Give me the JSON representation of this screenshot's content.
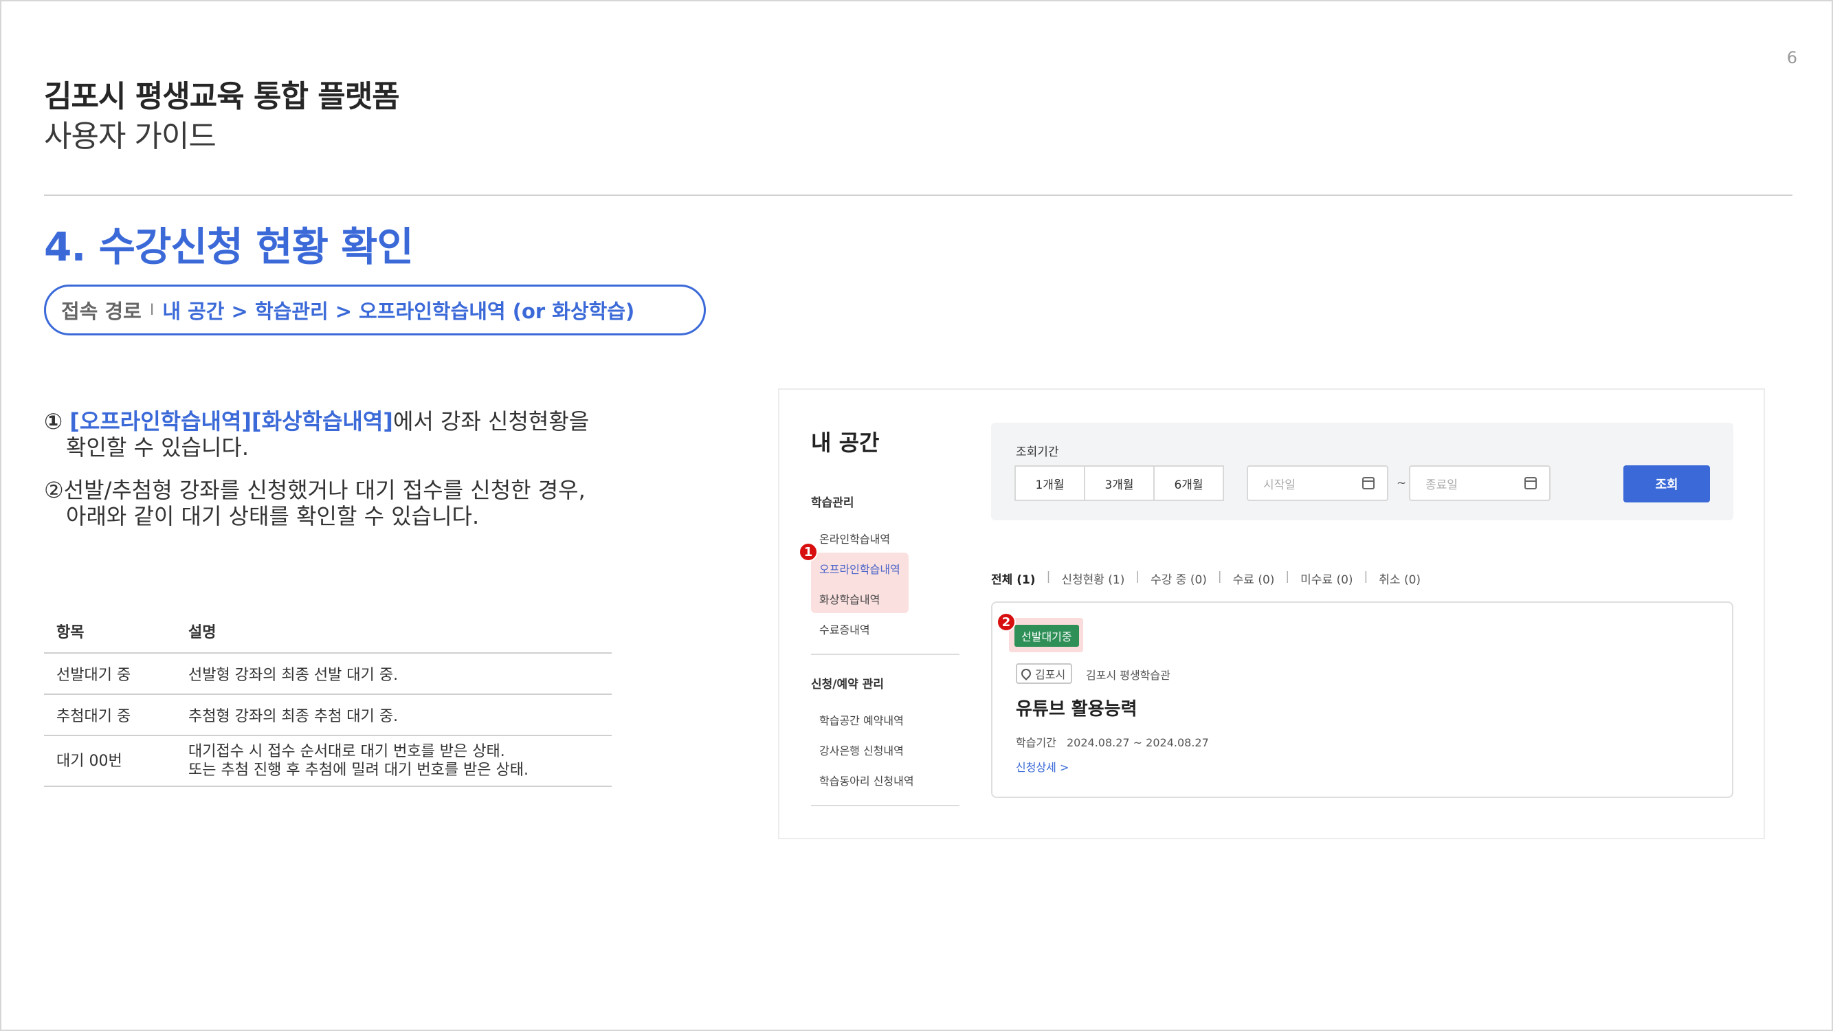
{
  "page": {
    "number": "6",
    "doc_title": "김포시 평생교육 통합 플랫폼",
    "doc_subtitle": "사용자 가이드",
    "section_title": "4. 수강신청 현황 확인",
    "path": {
      "label": "접속 경로",
      "separator": "I",
      "value": "내 공간 > 학습관리 > 오프라인학습내역 (or 화상학습)"
    }
  },
  "description": {
    "item1": {
      "num": "①",
      "highlight": "[오프라인학습내역][화상학습내역]",
      "text_line1": "에서 강좌 신청현황을",
      "text_line2": "확인할 수 있습니다."
    },
    "item2": {
      "line1": "②선발/추첨형 강좌를 신청했거나 대기 접수를 신청한 경우,",
      "line2": "아래와 같이 대기 상태를 확인할 수 있습니다."
    }
  },
  "table": {
    "headers": [
      "항목",
      "설명"
    ],
    "rows": [
      {
        "item": "선발대기 중",
        "desc1": "선발형 강좌의 최종 선발 대기 중.",
        "desc2": ""
      },
      {
        "item": "추첨대기 중",
        "desc1": "추첨형 강좌의 최종 추첨 대기 중.",
        "desc2": ""
      },
      {
        "item": "대기 00번",
        "desc1": "대기접수 시 접수 순서대로 대기 번호를 받은 상태.",
        "desc2": "또는 추첨 진행 후 추첨에 밀려 대기 번호를 받은 상태."
      }
    ]
  },
  "screenshot": {
    "title": "내 공간",
    "sidebar": {
      "group1": "학습관리",
      "group1_items": [
        "온라인학습내역",
        "오프라인학습내역",
        "화상학습내역",
        "수료증내역"
      ],
      "group2": "신청/예약 관리",
      "group2_items": [
        "학습공간 예약내역",
        "강사은행 신청내역",
        "학습동아리 신청내역"
      ]
    },
    "markers": [
      "1",
      "2"
    ],
    "filter": {
      "label": "조회기간",
      "periods": [
        "1개월",
        "3개월",
        "6개월"
      ],
      "start_placeholder": "시작일",
      "tilde": "~",
      "end_placeholder": "종료일",
      "search_label": "조회"
    },
    "tabs": [
      "전체 (1)",
      "신청현황 (1)",
      "수강 중 (0)",
      "수료 (0)",
      "미수료 (0)",
      "취소 (0)"
    ],
    "tab_separator": "|",
    "card": {
      "status": "선발대기중",
      "location": "김포시",
      "org": "김포시 평생학습관",
      "course_title": "유튜브 활용능력",
      "period_label": "학습기간",
      "period_value": "2024.08.27 ~ 2024.08.27",
      "detail_link": "신청상세 >"
    },
    "colors": {
      "accent": "#3b6ad8",
      "status_green": "#2e8f57",
      "marker_red": "#d80f0f",
      "highlight_pink": "#fbe0e0"
    }
  }
}
